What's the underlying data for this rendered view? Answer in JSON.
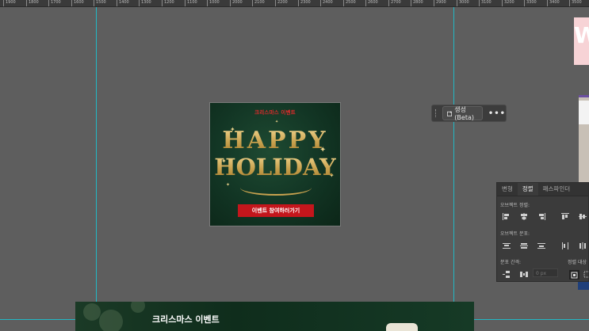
{
  "ruler": {
    "labels": [
      "1900",
      "1800",
      "1700",
      "1600",
      "1500",
      "1400",
      "1300",
      "1200",
      "1100",
      "1000",
      "2000",
      "2100",
      "2200",
      "2300",
      "2400",
      "2500",
      "2600",
      "2700",
      "2800",
      "2900",
      "3000",
      "3100",
      "3200",
      "3300",
      "3400",
      "3500"
    ]
  },
  "card": {
    "kicker": "크리스마스 이벤트",
    "happy": "HAPPY",
    "holiday": "HOLIDAY",
    "button": "이벤트 참여하러가기"
  },
  "floating_toolbar": {
    "generate_label": "생성(Beta)",
    "more_label": "•••",
    "icons": [
      "drag-handle-icon",
      "generate-icon",
      "more-icon"
    ]
  },
  "panel": {
    "tabs": [
      {
        "label": "변형",
        "active": false
      },
      {
        "label": "정렬",
        "active": true
      },
      {
        "label": "패스파인더",
        "active": false
      }
    ],
    "sections": {
      "align_objects": "오브젝트 정렬:",
      "distribute_objects": "오브젝트 분포:",
      "distribute_spacing": "분포 간격:",
      "align_to": "정렬 대상"
    },
    "spacing_value": "0 px"
  },
  "bottom_artboard": {
    "title": "크리스마스 이벤트"
  },
  "colors": {
    "canvas": "#5e5e5e",
    "guide": "#22b8c5",
    "card_green": "#123524",
    "gold": "#c9a24f",
    "button_red": "#c4161c",
    "kicker_red": "#e12b2b"
  }
}
